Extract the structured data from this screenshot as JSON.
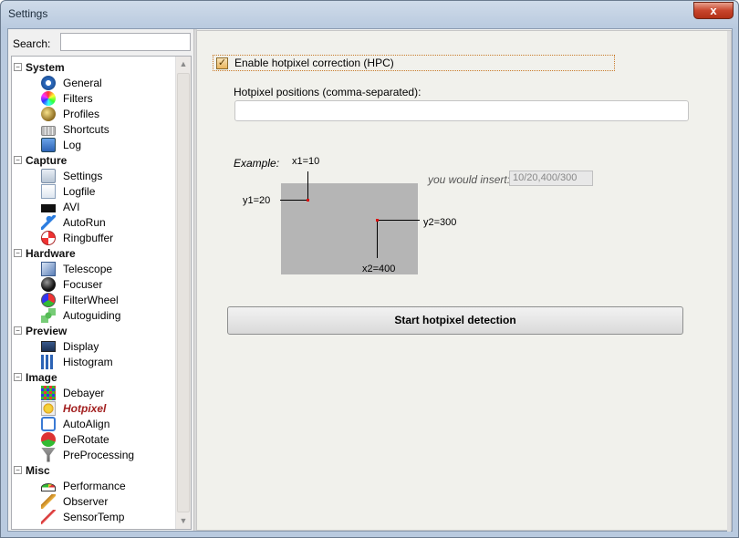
{
  "window": {
    "title": "Settings",
    "close_glyph": "x"
  },
  "search": {
    "label": "Search:",
    "value": ""
  },
  "tree": {
    "categories": [
      {
        "label": "System",
        "expander": "−",
        "items": [
          {
            "label": "General",
            "icon": "gear-icon"
          },
          {
            "label": "Filters",
            "icon": "color-wheel-icon"
          },
          {
            "label": "Profiles",
            "icon": "profiles-icon"
          },
          {
            "label": "Shortcuts",
            "icon": "keyboard-icon"
          },
          {
            "label": "Log",
            "icon": "info-icon"
          }
        ]
      },
      {
        "label": "Capture",
        "expander": "−",
        "items": [
          {
            "label": "Settings",
            "icon": "capture-settings-icon"
          },
          {
            "label": "Logfile",
            "icon": "logfile-icon"
          },
          {
            "label": "AVI",
            "icon": "avi-icon"
          },
          {
            "label": "AutoRun",
            "icon": "running-man-icon"
          },
          {
            "label": "Ringbuffer",
            "icon": "lifebuoy-icon"
          }
        ]
      },
      {
        "label": "Hardware",
        "expander": "−",
        "items": [
          {
            "label": "Telescope",
            "icon": "telescope-icon"
          },
          {
            "label": "Focuser",
            "icon": "focuser-icon"
          },
          {
            "label": "FilterWheel",
            "icon": "filterwheel-icon"
          },
          {
            "label": "Autoguiding",
            "icon": "autoguiding-icon"
          }
        ]
      },
      {
        "label": "Preview",
        "expander": "−",
        "items": [
          {
            "label": "Display",
            "icon": "monitor-icon"
          },
          {
            "label": "Histogram",
            "icon": "histogram-icon"
          }
        ]
      },
      {
        "label": "Image",
        "expander": "−",
        "items": [
          {
            "label": "Debayer",
            "icon": "bayer-grid-icon"
          },
          {
            "label": "Hotpixel",
            "icon": "hotpixel-star-icon",
            "selected": true
          },
          {
            "label": "AutoAlign",
            "icon": "align-icon"
          },
          {
            "label": "DeRotate",
            "icon": "derotate-icon"
          },
          {
            "label": "PreProcessing",
            "icon": "funnel-icon"
          }
        ]
      },
      {
        "label": "Misc",
        "expander": "−",
        "items": [
          {
            "label": "Performance",
            "icon": "gauge-icon"
          },
          {
            "label": "Observer",
            "icon": "observer-icon"
          },
          {
            "label": "SensorTemp",
            "icon": "thermometer-icon"
          }
        ]
      }
    ]
  },
  "hotpixel": {
    "enable_label": "Enable hotpixel correction (HPC)",
    "enable_checked": true,
    "positions_label": "Hotpixel positions (comma-separated):",
    "positions_value": "",
    "example_label": "Example:",
    "diagram": {
      "x1_label": "x1=10",
      "y1_label": "y1=20",
      "y2_label": "y2=300",
      "x2_label": "x2=400"
    },
    "insert_label": "you would insert:",
    "insert_value": "10/20,400/300",
    "start_button": "Start hotpixel detection"
  },
  "colors": {
    "selected_item": "#a32020",
    "hot_pixel_dot": "#dd1111",
    "checkbox_fill": "#e9b55d"
  }
}
